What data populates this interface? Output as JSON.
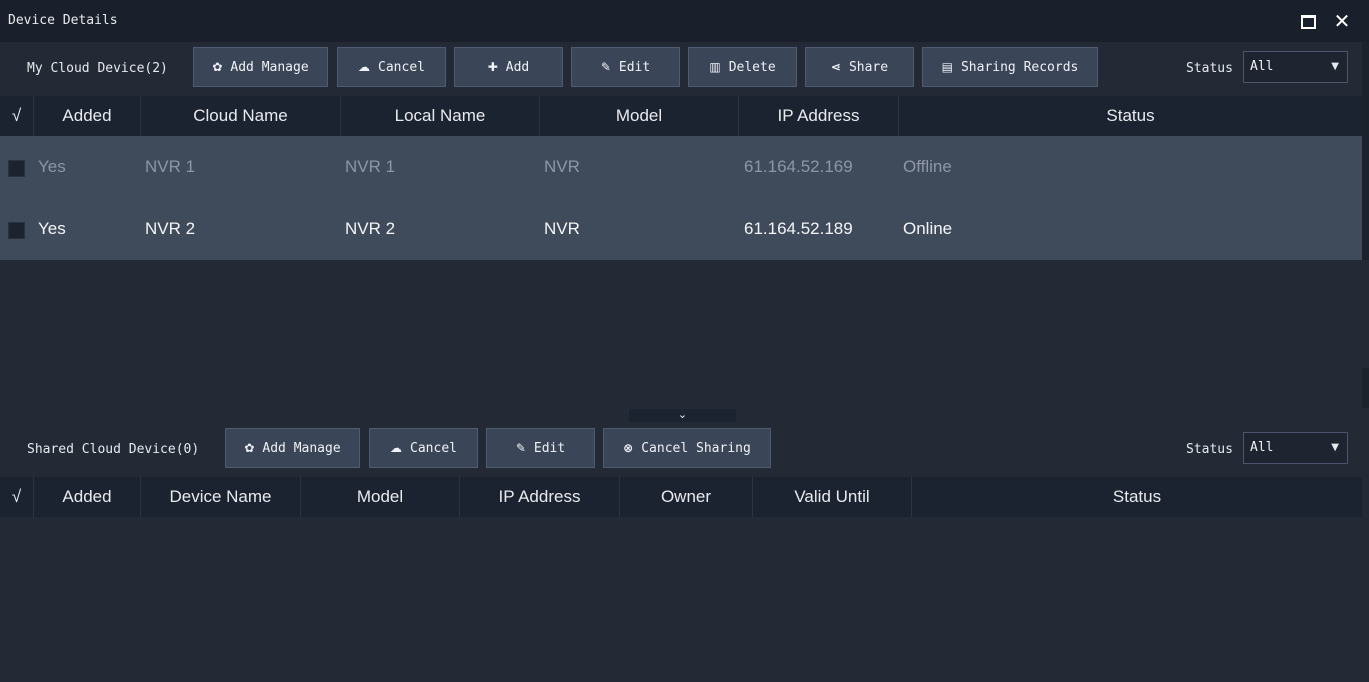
{
  "window": {
    "title": "Device Details",
    "maximize_icon": "maximize-icon",
    "close_icon": "close-icon",
    "close_glyph": "✕"
  },
  "my_cloud": {
    "label": "My Cloud Device(2)",
    "buttons": [
      {
        "icon": "gear-icon",
        "glyph": "✿",
        "label": "Add Manage"
      },
      {
        "icon": "cancel-cloud-icon",
        "glyph": "☁",
        "label": "Cancel"
      },
      {
        "icon": "plus-icon",
        "glyph": "✚",
        "label": "Add"
      },
      {
        "icon": "pencil-icon",
        "glyph": "✎",
        "label": "Edit"
      },
      {
        "icon": "trash-icon",
        "glyph": "▥",
        "label": "Delete"
      },
      {
        "icon": "share-icon",
        "glyph": "⋖",
        "label": "Share"
      },
      {
        "icon": "records-icon",
        "glyph": "▤",
        "label": "Sharing Records"
      }
    ],
    "status_label": "Status",
    "status_value": "All",
    "columns": [
      "√",
      "Added",
      "Cloud Name",
      "Local Name",
      "Model",
      "IP Address",
      "Status"
    ],
    "rows": [
      {
        "added": "Yes",
        "cloud_name": "NVR 1",
        "local_name": "NVR 1",
        "model": "NVR",
        "ip": "61.164.52.169",
        "status": "Offline"
      },
      {
        "added": "Yes",
        "cloud_name": "NVR 2",
        "local_name": "NVR 2",
        "model": "NVR",
        "ip": "61.164.52.189",
        "status": "Online"
      }
    ]
  },
  "splitter": {
    "glyph": "⌄"
  },
  "shared_cloud": {
    "label": "Shared Cloud Device(0)",
    "buttons": [
      {
        "icon": "gear-icon",
        "glyph": "✿",
        "label": "Add Manage"
      },
      {
        "icon": "cancel-cloud-icon",
        "glyph": "☁",
        "label": "Cancel"
      },
      {
        "icon": "pencil-icon",
        "glyph": "✎",
        "label": "Edit"
      },
      {
        "icon": "cancel-circle-icon",
        "glyph": "⊗",
        "label": "Cancel Sharing"
      }
    ],
    "status_label": "Status",
    "status_value": "All",
    "columns": [
      "√",
      "Added",
      "Device Name",
      "Model",
      "IP Address",
      "Owner",
      "Valid Until",
      "Status"
    ]
  },
  "colors": {
    "background": "#232a36",
    "titlebar": "#1a202b",
    "header": "#1b2230",
    "row": "#3f4a5b",
    "button": "#3a4558",
    "offline_text": "#8c96a6",
    "online_text": "#f4f6f8"
  }
}
